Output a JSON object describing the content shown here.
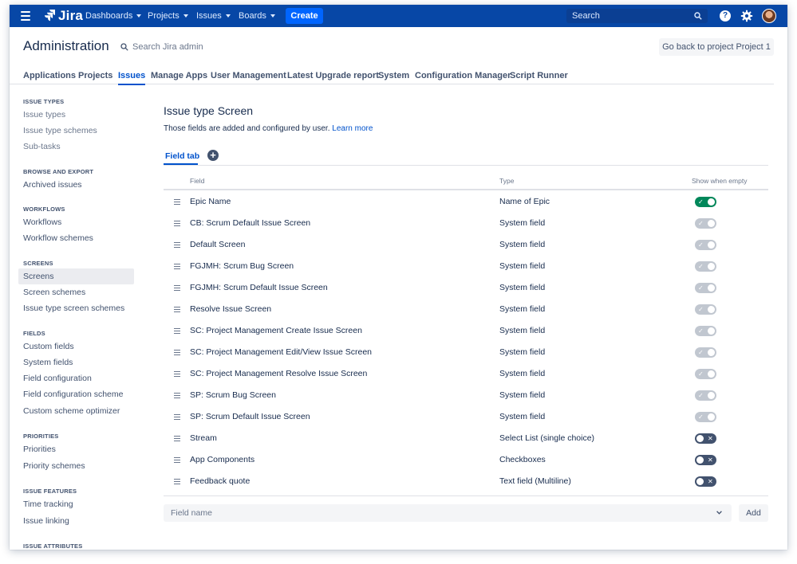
{
  "topnav": {
    "app_name": "Jira",
    "items": [
      {
        "label": "Dashboards"
      },
      {
        "label": "Projects"
      },
      {
        "label": "Issues"
      },
      {
        "label": "Boards"
      }
    ],
    "create_label": "Create",
    "search_placeholder": "Search",
    "help_glyph": "?"
  },
  "header": {
    "title": "Administration",
    "search_placeholder": "Search Jira admin",
    "back_button": "Go back to project Project 1"
  },
  "tabs": [
    {
      "label": "Applications"
    },
    {
      "label": "Projects"
    },
    {
      "label": "Issues",
      "active": true
    },
    {
      "label": "Manage Apps"
    },
    {
      "label": "User Management"
    },
    {
      "label": "Latest Upgrade report"
    },
    {
      "label": "System"
    },
    {
      "label": "Configuration Manager"
    },
    {
      "label": "Script Runner"
    }
  ],
  "sidebar": {
    "sections": [
      {
        "heading": "ISSUE TYPES",
        "items": [
          "Issue types",
          "Issue type schemes",
          "Sub-tasks"
        ]
      },
      {
        "heading": "BROWSE AND EXPORT",
        "items": [
          "Archived issues"
        ]
      },
      {
        "heading": "WORKFLOWS",
        "items": [
          "Workflows",
          "Workflow schemes"
        ]
      },
      {
        "heading": "SCREENS",
        "items": [
          "Screens",
          "Screen schemes",
          "Issue type screen schemes"
        ]
      },
      {
        "heading": "FIELDS",
        "items": [
          "Custom fields",
          "System fields",
          "Field configuration",
          "Field configuration scheme",
          "Custom scheme optimizer"
        ]
      },
      {
        "heading": "PRIORITIES",
        "items": [
          "Priorities",
          "Priority schemes"
        ]
      },
      {
        "heading": "ISSUE FEATURES",
        "items": [
          "Time tracking",
          "Issue linking"
        ]
      },
      {
        "heading": "ISSUE ATTRIBUTES",
        "items": []
      }
    ],
    "selected": "Screens"
  },
  "main": {
    "title": "Issue type Screen",
    "description": "Those fields are added and configured by user.",
    "learn_more": "Learn more",
    "field_tab": "Field tab",
    "add_tab_glyph": "+",
    "columns": {
      "field": "Field",
      "type": "Type",
      "show": "Show when empty"
    },
    "rows": [
      {
        "field": "Epic Name",
        "type": "Name of Epic",
        "show_when_empty": "on"
      },
      {
        "field": "CB: Scrum Default Issue Screen",
        "type": "System field",
        "show_when_empty": "disabled"
      },
      {
        "field": "Default Screen",
        "type": "System field",
        "show_when_empty": "disabled"
      },
      {
        "field": "FGJMH: Scrum Bug Screen",
        "type": "System field",
        "show_when_empty": "disabled"
      },
      {
        "field": "FGJMH: Scrum Default Issue Screen",
        "type": "System field",
        "show_when_empty": "disabled"
      },
      {
        "field": "Resolve Issue Screen",
        "type": "System field",
        "show_when_empty": "disabled"
      },
      {
        "field": "SC: Project Management Create Issue Screen",
        "type": "System field",
        "show_when_empty": "disabled"
      },
      {
        "field": "SC: Project Management Edit/View Issue Screen",
        "type": "System field",
        "show_when_empty": "disabled"
      },
      {
        "field": "SC: Project Management Resolve Issue Screen",
        "type": "System field",
        "show_when_empty": "disabled"
      },
      {
        "field": "SP: Scrum Bug Screen",
        "type": "System field",
        "show_when_empty": "disabled"
      },
      {
        "field": "SP: Scrum Default Issue Screen",
        "type": "System field",
        "show_when_empty": "disabled"
      },
      {
        "field": "Stream",
        "type": "Select List (single choice)",
        "show_when_empty": "off"
      },
      {
        "field": "App Components",
        "type": "Checkboxes",
        "show_when_empty": "off"
      },
      {
        "field": "Feedback quote",
        "type": "Text field (Multiline)",
        "show_when_empty": "off"
      }
    ],
    "field_select_placeholder": "Field name",
    "add_button": "Add"
  },
  "colors": {
    "nav_bg": "#0747a6",
    "primary": "#0052cc",
    "create_bg": "#0065ff",
    "toggle_on": "#00875a",
    "toggle_disabled": "#c1c7d0",
    "toggle_off": "#42526e"
  },
  "icons": {
    "menu": "menu-icon",
    "logo": "jira-logo-icon",
    "search": "search-icon",
    "help": "help-icon",
    "settings": "gear-icon",
    "drag": "drag-handle-icon",
    "add_tab": "add-icon",
    "dropdown": "chevron-down-icon"
  }
}
